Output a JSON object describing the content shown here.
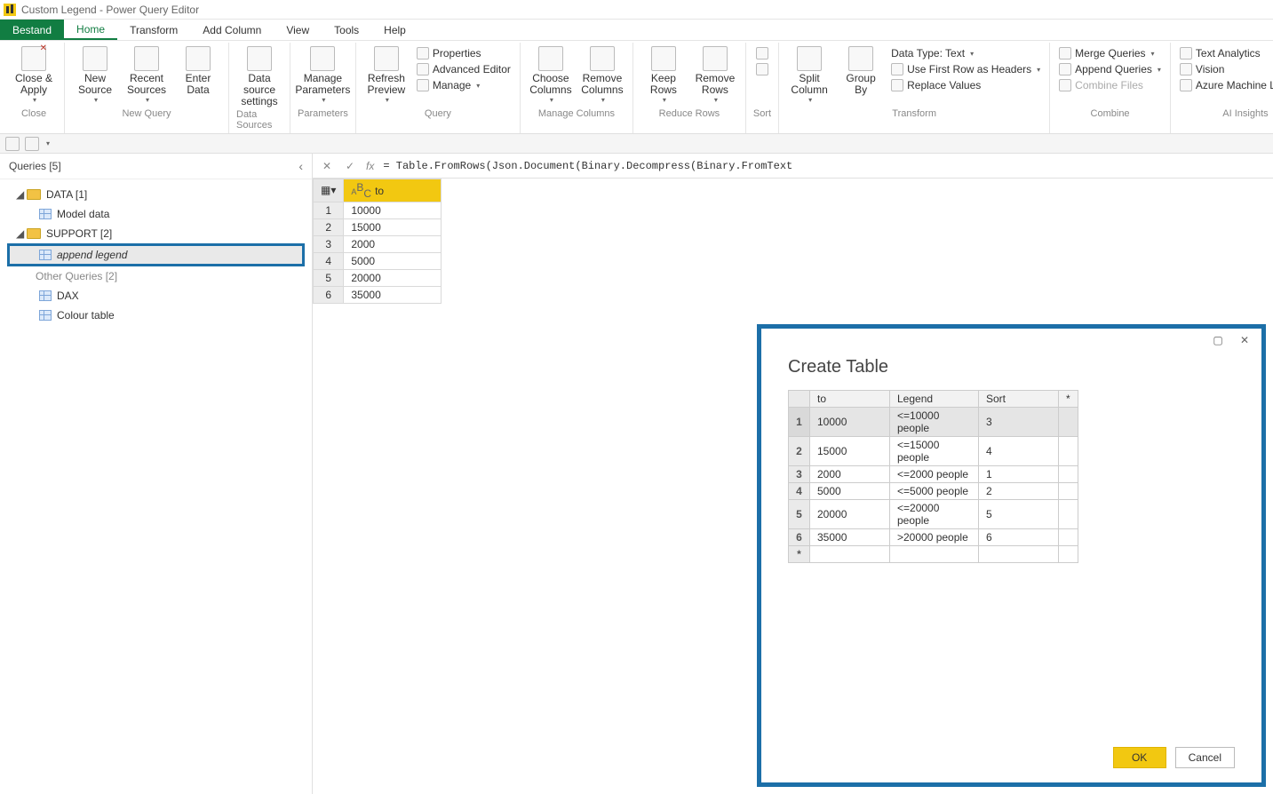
{
  "window": {
    "title": "Custom Legend - Power Query Editor"
  },
  "tabs": {
    "bestand": "Bestand",
    "home": "Home",
    "transform": "Transform",
    "add_column": "Add Column",
    "view": "View",
    "tools": "Tools",
    "help": "Help"
  },
  "ribbon": {
    "close": {
      "label": "Close &\nApply",
      "group": "Close"
    },
    "newquery": {
      "new_source": "New\nSource",
      "recent_sources": "Recent\nSources",
      "enter_data": "Enter\nData",
      "group": "New Query"
    },
    "datasources": {
      "settings": "Data source\nsettings",
      "group": "Data Sources"
    },
    "parameters": {
      "manage": "Manage\nParameters",
      "group": "Parameters"
    },
    "query": {
      "refresh": "Refresh\nPreview",
      "properties": "Properties",
      "advanced": "Advanced Editor",
      "manage": "Manage",
      "group": "Query"
    },
    "manage_columns": {
      "choose": "Choose\nColumns",
      "remove": "Remove\nColumns",
      "group": "Manage Columns"
    },
    "reduce_rows": {
      "keep": "Keep\nRows",
      "remove": "Remove\nRows",
      "group": "Reduce Rows"
    },
    "sort": {
      "group": "Sort"
    },
    "transform": {
      "split": "Split\nColumn",
      "groupby": "Group\nBy",
      "datatype": "Data Type: Text",
      "first_row": "Use First Row as Headers",
      "replace": "Replace Values",
      "group": "Transform"
    },
    "combine": {
      "merge": "Merge Queries",
      "append": "Append Queries",
      "combine_files": "Combine Files",
      "group": "Combine"
    },
    "ai": {
      "text": "Text Analytics",
      "vision": "Vision",
      "azure": "Azure Machine Learning",
      "group": "AI Insights"
    }
  },
  "queries_panel": {
    "title": "Queries [5]",
    "folder_data": "DATA [1]",
    "item_model": "Model data",
    "folder_support": "SUPPORT [2]",
    "item_append": "append legend",
    "folder_other": "Other Queries [2]",
    "item_dax": "DAX",
    "item_colour": "Colour table"
  },
  "formula": {
    "text": "= Table.FromRows(Json.Document(Binary.Decompress(Binary.FromText"
  },
  "preview": {
    "col_to": "to",
    "rows": [
      "10000",
      "15000",
      "2000",
      "5000",
      "20000",
      "35000"
    ]
  },
  "dialog": {
    "title": "Create Table",
    "headers": {
      "to": "to",
      "legend": "Legend",
      "sort": "Sort",
      "star": "*"
    },
    "rows": [
      {
        "n": "1",
        "to": "10000",
        "legend": "<=10000 people",
        "sort": "3"
      },
      {
        "n": "2",
        "to": "15000",
        "legend": "<=15000 people",
        "sort": "4"
      },
      {
        "n": "3",
        "to": "2000",
        "legend": "<=2000 people",
        "sort": "1"
      },
      {
        "n": "4",
        "to": "5000",
        "legend": "<=5000 people",
        "sort": "2"
      },
      {
        "n": "5",
        "to": "20000",
        "legend": "<=20000 people",
        "sort": "5"
      },
      {
        "n": "6",
        "to": "35000",
        "legend": ">20000 people",
        "sort": "6"
      }
    ],
    "star_row": "*",
    "ok": "OK",
    "cancel": "Cancel"
  }
}
